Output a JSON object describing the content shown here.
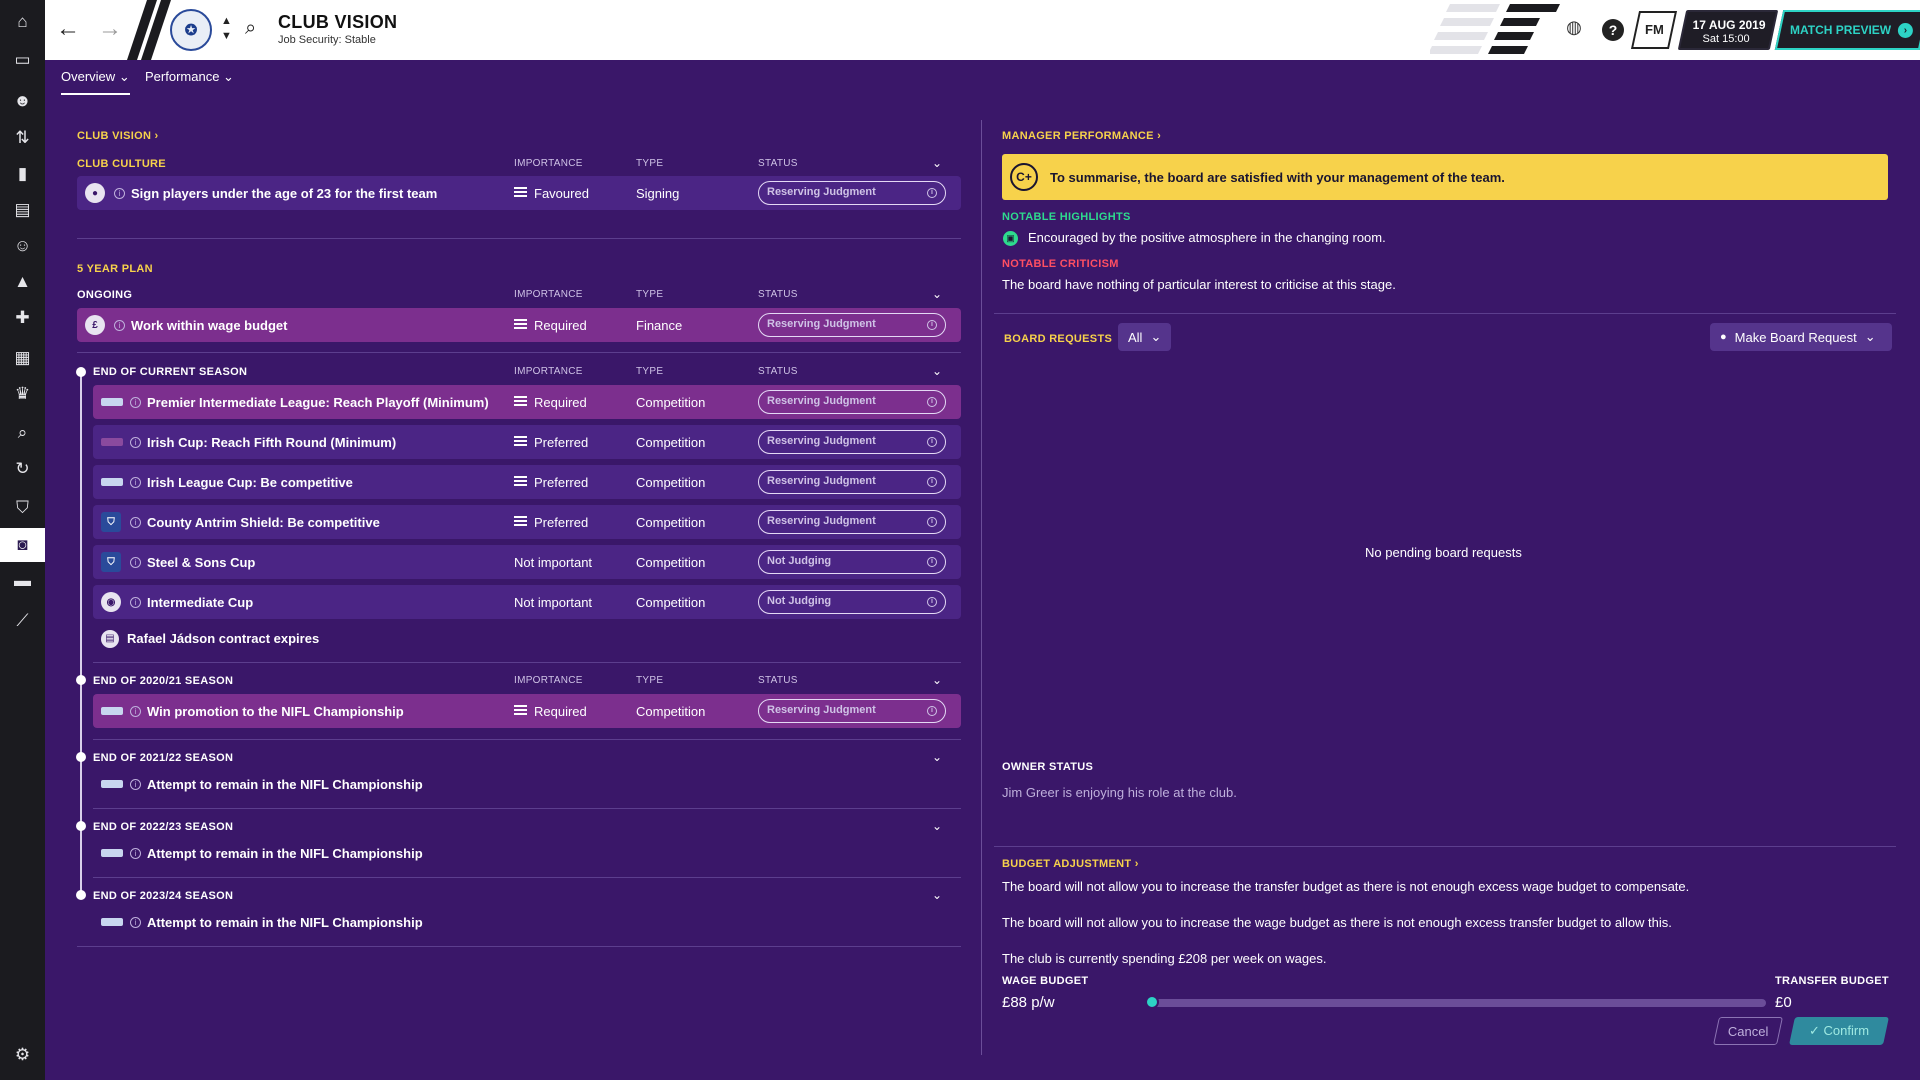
{
  "header": {
    "title": "CLUB VISION",
    "subtitle": "Job Security: Stable",
    "date": "17 AUG 2019",
    "time": "Sat 15:00",
    "match_preview": "MATCH PREVIEW",
    "fm_label": "FM",
    "help_label": "?"
  },
  "tabs": [
    {
      "label": "Overview",
      "active": true
    },
    {
      "label": "Performance",
      "active": false
    }
  ],
  "sidebar": {
    "items": [
      "home-icon",
      "inbox-icon",
      "squad-icon",
      "tactics-icon",
      "data-hub-icon",
      "reports-icon",
      "staff-icon",
      "training-icon",
      "medical-centre-icon",
      "schedule-icon",
      "competitions-icon",
      "scouting-icon",
      "transfers-icon",
      "club-info-icon",
      "club-vision-icon",
      "finances-icon",
      "dev-centre-icon"
    ],
    "active_index": 14
  },
  "left": {
    "club_vision_link": "CLUB VISION",
    "club_culture": {
      "title": "CLUB CULTURE",
      "columns": {
        "importance": "IMPORTANCE",
        "type": "TYPE",
        "status": "STATUS"
      },
      "rows": [
        {
          "label": "Sign players under the age of 23 for the first team",
          "importance": "Favoured",
          "type": "Signing",
          "status": "Reserving Judgment"
        }
      ]
    },
    "five_year_plan": {
      "title": "5 YEAR PLAN",
      "ongoing": {
        "title": "ONGOING",
        "rows": [
          {
            "label": "Work within wage budget",
            "importance": "Required",
            "type": "Finance",
            "status": "Reserving Judgment"
          }
        ]
      },
      "current_season": {
        "title": "END OF CURRENT SEASON",
        "rows": [
          {
            "label": "Premier Intermediate League: Reach Playoff (Minimum)",
            "importance": "Required",
            "type": "Competition",
            "status": "Reserving Judgment"
          },
          {
            "label": "Irish Cup: Reach Fifth Round (Minimum)",
            "importance": "Preferred",
            "type": "Competition",
            "status": "Reserving Judgment"
          },
          {
            "label": "Irish League Cup: Be competitive",
            "importance": "Preferred",
            "type": "Competition",
            "status": "Reserving Judgment"
          },
          {
            "label": "County Antrim Shield: Be competitive",
            "importance": "Preferred",
            "type": "Competition",
            "status": "Reserving Judgment"
          },
          {
            "label": "Steel & Sons Cup",
            "importance": "Not important",
            "type": "Competition",
            "status": "Not Judging"
          },
          {
            "label": "Intermediate Cup",
            "importance": "Not important",
            "type": "Competition",
            "status": "Not Judging"
          }
        ],
        "contract_note": "Rafael Jádson contract expires"
      },
      "season_2021": {
        "title": "END OF 2020/21 SEASON",
        "rows": [
          {
            "label": "Win promotion to the NIFL Championship",
            "importance": "Required",
            "type": "Competition",
            "status": "Reserving Judgment"
          }
        ]
      },
      "season_2122": {
        "title": "END OF 2021/22 SEASON",
        "item": "Attempt to remain in the NIFL Championship"
      },
      "season_2223": {
        "title": "END OF 2022/23 SEASON",
        "item": "Attempt to remain in the NIFL Championship"
      },
      "season_2324": {
        "title": "END OF 2023/24 SEASON",
        "item": "Attempt to remain in the NIFL Championship"
      }
    }
  },
  "right": {
    "manager_performance": "MANAGER PERFORMANCE",
    "grade": "C+",
    "summary": "To summarise, the board are satisfied with your management of the team.",
    "highlights_title": "NOTABLE HIGHLIGHTS",
    "highlight": "Encouraged by the positive atmosphere in the changing room.",
    "criticism_title": "NOTABLE CRITICISM",
    "criticism": "The board have nothing of particular interest to criticise at this stage.",
    "board_requests_title": "BOARD REQUESTS",
    "board_requests_filter": "All",
    "make_request": "Make Board Request",
    "no_requests": "No pending board requests",
    "owner_status_title": "OWNER STATUS",
    "owner_status": "Jim Greer is enjoying his role at the club.",
    "budget_title": "BUDGET ADJUSTMENT",
    "budget_line1": "The board will not allow you to increase the transfer budget as there is not enough excess wage budget to compensate.",
    "budget_line2": "The board will not allow you to increase the wage budget as there is not enough excess transfer budget to allow this.",
    "budget_line3": "The club is currently spending £208 per week on wages.",
    "wage_budget_label": "WAGE BUDGET",
    "wage_budget_value": "£88 p/w",
    "transfer_budget_label": "TRANSFER BUDGET",
    "transfer_budget_value": "£0",
    "slider_position": 0.0,
    "cancel_label": "Cancel",
    "confirm_label": "Confirm"
  },
  "colors": {
    "accent": "#2dd3c5",
    "highlight": "#f7d24b",
    "criticism": "#ff4f62",
    "positive": "#2edb8e",
    "background": "#3a1769"
  }
}
